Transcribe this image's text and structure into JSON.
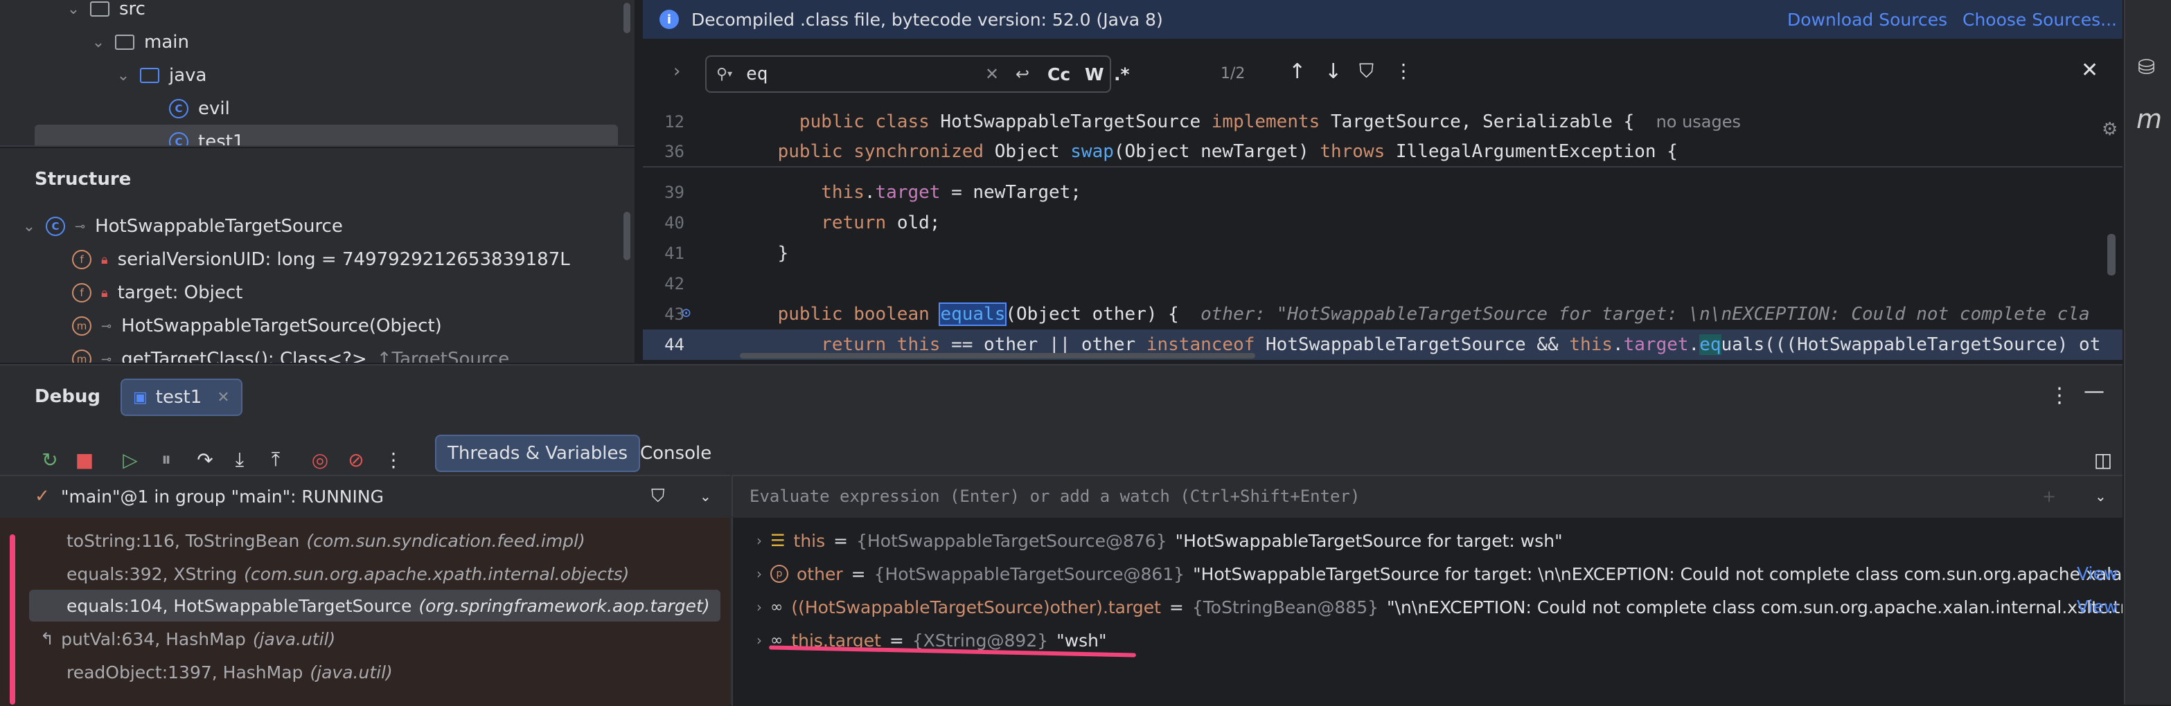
{
  "project_tree": {
    "items": [
      {
        "label": "src",
        "indent": 1,
        "icon": "folder-icon"
      },
      {
        "label": "main",
        "indent": 2,
        "icon": "folder-icon"
      },
      {
        "label": "java",
        "indent": 3,
        "icon": "folder-blue-icon"
      },
      {
        "label": "evil",
        "indent": 4,
        "icon": "class-icon"
      },
      {
        "label": "test1",
        "indent": 4,
        "icon": "class-icon"
      }
    ]
  },
  "structure": {
    "title": "Structure",
    "root": "HotSwappableTargetSource",
    "members": [
      "serialVersionUID: long = 7497929212653839187L",
      "target: Object",
      "HotSwappableTargetSource(Object)",
      "getTargetClass(): Class<?>",
      "↑TargetSource"
    ]
  },
  "editor": {
    "banner": "Decompiled .class file, bytecode version: 52.0 (Java 8)",
    "download_sources": "Download Sources",
    "choose_sources": "Choose Sources...",
    "find_query": "eq",
    "find_opts": [
      "Cc",
      "W",
      ".*"
    ],
    "find_count": "1/2",
    "lines": [
      {
        "n": "12",
        "code": "public class HotSwappableTargetSource implements TargetSource, Serializable {",
        "hint": "no usages"
      },
      {
        "n": "36",
        "code": "    public synchronized Object swap(Object newTarget) throws IllegalArgumentException {",
        "hint": ""
      },
      {
        "n": "39",
        "code": "        this.target = newTarget;",
        "hint": ""
      },
      {
        "n": "40",
        "code": "        return old;",
        "hint": ""
      },
      {
        "n": "41",
        "code": "    }",
        "hint": ""
      },
      {
        "n": "42",
        "code": "",
        "hint": ""
      },
      {
        "n": "43",
        "code": "    public boolean equals(Object other) {",
        "hint": "other: \"HotSwappableTargetSource for target: \\n\\nEXCEPTION: Could not complete cla"
      },
      {
        "n": "44",
        "code": "        return this == other || other instanceof HotSwappableTargetSource && this.target.equals(((HotSwappableTargetSource) ot",
        "hint": ""
      }
    ]
  },
  "debug": {
    "title": "Debug",
    "session_tab": "test1",
    "tab_threads": "Threads & Variables",
    "tab_console": "Console",
    "thread_status": "\"main\"@1 in group \"main\": RUNNING",
    "eval_placeholder": "Evaluate expression (Enter) or add a watch (Ctrl+Shift+Enter)",
    "frames": [
      {
        "method": "toString:116, ToStringBean",
        "pkg": "(com.sun.syndication.feed.impl)"
      },
      {
        "method": "equals:392, XString",
        "pkg": "(com.sun.org.apache.xpath.internal.objects)"
      },
      {
        "method": "equals:104, HotSwappableTargetSource",
        "pkg": "(org.springframework.aop.target)"
      },
      {
        "method": "putVal:634, HashMap",
        "pkg": "(java.util)"
      },
      {
        "method": "readObject:1397, HashMap",
        "pkg": "(java.util)"
      }
    ],
    "variables": [
      {
        "name": "this",
        "type": "{HotSwappableTargetSource@876}",
        "value": "\"HotSwappableTargetSource for target: wsh\"",
        "view": ""
      },
      {
        "name": "other",
        "type": "{HotSwappableTargetSource@861}",
        "value": "\"HotSwappableTargetSource for target: \\n\\nEXCEPTION: Could not complete class com.sun.org.apache.xalan.interr...",
        "view": "View"
      },
      {
        "name": "((HotSwappableTargetSource)other).target",
        "type": "{ToStringBean@885}",
        "value": "\"\\n\\nEXCEPTION: Could not complete class com.sun.org.apache.xalan.internal.xsltc.trax.Tem...",
        "view": "View"
      },
      {
        "name": "this.target",
        "type": "{XString@892}",
        "value": "\"wsh\"",
        "view": ""
      }
    ]
  },
  "colors": {
    "accent": "#548af7",
    "annotation": "#f0447a"
  }
}
